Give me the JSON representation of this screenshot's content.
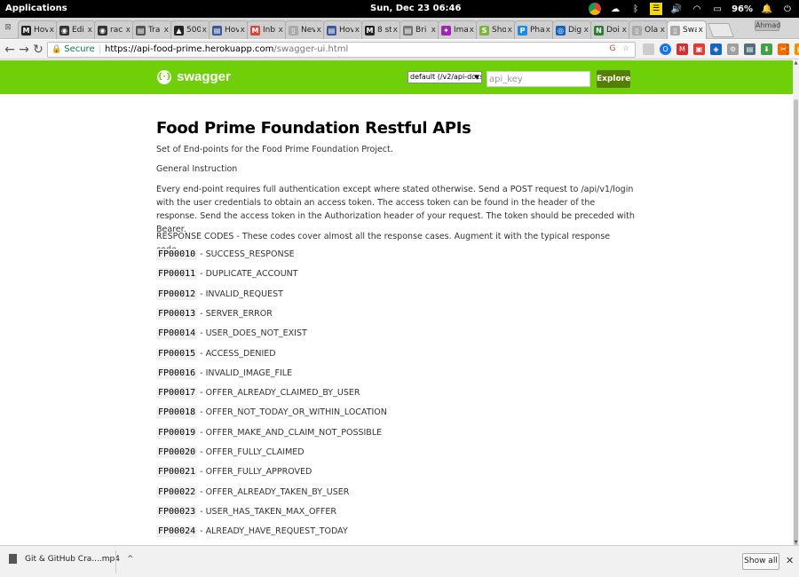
{
  "os": {
    "apps_label": "Applications",
    "clock": "Sun, Dec 23   06:46",
    "battery": "96%"
  },
  "tabs": [
    {
      "label": "Hov",
      "color": "#222222",
      "glyph": "M"
    },
    {
      "label": "Edi",
      "color": "#333333",
      "glyph": "◉"
    },
    {
      "label": "rac",
      "color": "#333333",
      "glyph": "◉"
    },
    {
      "label": "Tra",
      "color": "#555555",
      "glyph": "▤"
    },
    {
      "label": "500",
      "color": "#222222",
      "glyph": "▲"
    },
    {
      "label": "Hov",
      "color": "#3b5998",
      "glyph": "▤"
    },
    {
      "label": "Inb",
      "color": "#d44638",
      "glyph": "M"
    },
    {
      "label": "Nev",
      "color": "#aaaaaa",
      "glyph": "▯"
    },
    {
      "label": "Hov",
      "color": "#3b5998",
      "glyph": "▤"
    },
    {
      "label": "8 st",
      "color": "#222222",
      "glyph": "M"
    },
    {
      "label": "Bri",
      "color": "#777777",
      "glyph": "▤"
    },
    {
      "label": "Ima",
      "color": "#9c27b0",
      "glyph": "✦"
    },
    {
      "label": "Sho",
      "color": "#7cb342",
      "glyph": "S"
    },
    {
      "label": "Pha",
      "color": "#1e88e5",
      "glyph": "P"
    },
    {
      "label": "Dig",
      "color": "#1565c0",
      "glyph": "◎"
    },
    {
      "label": "Doi",
      "color": "#2e7d32",
      "glyph": "N"
    },
    {
      "label": "Ola",
      "color": "#aaaaaa",
      "glyph": "▯"
    },
    {
      "label": "Swa",
      "color": "#aaaaaa",
      "glyph": "▯",
      "active": true
    }
  ],
  "tab_close_glyph": "x",
  "profile_label": "Ahmad",
  "address": {
    "secure_label": "Secure",
    "separator": "|",
    "url_host": "https://api-food-prime.herokuapp.com",
    "url_path": "/swagger-ui.html"
  },
  "swagger": {
    "logo_text": "swagger",
    "spec_select": "default (/v2/api-docs)",
    "api_key_placeholder": "api_key",
    "explore_label": "Explore"
  },
  "content": {
    "title": "Food Prime Foundation Restful APIs",
    "description": "Set of End-points for the Food Prime Foundation Project.",
    "general_heading": "General Instruction",
    "instructions": "Every end-point requires full authentication except where stated otherwise. Send a POST request to /api/v1/login with the user credentials to obtain an access token. The access token can be found in the header of the response. Send the access token in the Authorization header of your request. The token should be preceded with Bearer.",
    "response_codes_intro": "RESPONSE CODES - These codes cover almost all the response cases. Augment it with the typical response code.",
    "codes": [
      {
        "code": "FP00010",
        "desc": "- SUCCESS_RESPONSE"
      },
      {
        "code": "FP00011",
        "desc": "- DUPLICATE_ACCOUNT"
      },
      {
        "code": "FP00012",
        "desc": "- INVALID_REQUEST"
      },
      {
        "code": "FP00013",
        "desc": "- SERVER_ERROR"
      },
      {
        "code": "FP00014",
        "desc": "- USER_DOES_NOT_EXIST"
      },
      {
        "code": "FP00015",
        "desc": "- ACCESS_DENIED"
      },
      {
        "code": "FP00016",
        "desc": "- INVALID_IMAGE_FILE"
      },
      {
        "code": "FP00017",
        "desc": "- OFFER_ALREADY_CLAIMED_BY_USER"
      },
      {
        "code": "FP00018",
        "desc": "- OFFER_NOT_TODAY_OR_WITHIN_LOCATION"
      },
      {
        "code": "FP00019",
        "desc": "- OFFER_MAKE_AND_CLAIM_NOT_POSSIBLE"
      },
      {
        "code": "FP00020",
        "desc": "- OFFER_FULLY_CLAIMED"
      },
      {
        "code": "FP00021",
        "desc": "- OFFER_FULLY_APPROVED"
      },
      {
        "code": "FP00022",
        "desc": "- OFFER_ALREADY_TAKEN_BY_USER"
      },
      {
        "code": "FP00023",
        "desc": "- USER_HAS_TAKEN_MAX_OFFER"
      },
      {
        "code": "FP00024",
        "desc": "- ALREADY_HAVE_REQUEST_TODAY"
      }
    ]
  },
  "download": {
    "filename": "Git & GitHub Cra....mp4",
    "show_all_label": "Show all"
  },
  "colors": {
    "swagger_green": "#6fd009",
    "explore_button": "#547f00",
    "secure_green": "#0b8043"
  }
}
